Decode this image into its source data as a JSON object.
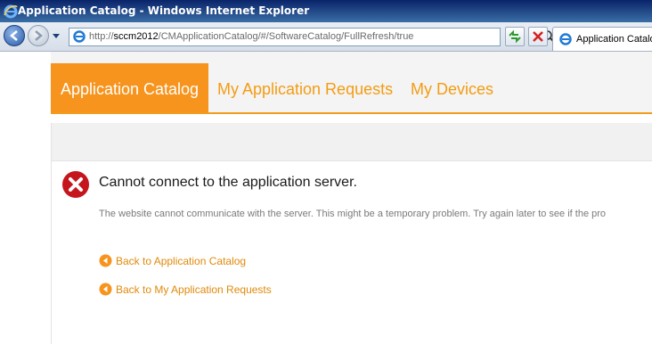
{
  "window": {
    "title": "Application Catalog - Windows Internet Explorer"
  },
  "address_bar": {
    "url_prefix": "http://",
    "url_host": "sccm2012",
    "url_path": "/CMApplicationCatalog/#/SoftwareCatalog/FullRefresh/true"
  },
  "browser_tab": {
    "label": "Application Catalog"
  },
  "app_nav": {
    "tabs": [
      {
        "label": "Application Catalog",
        "active": true
      },
      {
        "label": "My Application Requests",
        "active": false
      },
      {
        "label": "My Devices",
        "active": false
      }
    ]
  },
  "error": {
    "title": "Cannot connect to the application server.",
    "message": "The website cannot communicate with the server. This might be a temporary problem. Try again later to see if the pro"
  },
  "links": [
    {
      "label": "Back to Application Catalog"
    },
    {
      "label": "Back to My Application Requests"
    }
  ],
  "colors": {
    "accent_orange": "#f7941d",
    "link_orange": "#e08a0b",
    "error_red": "#c4161c"
  }
}
